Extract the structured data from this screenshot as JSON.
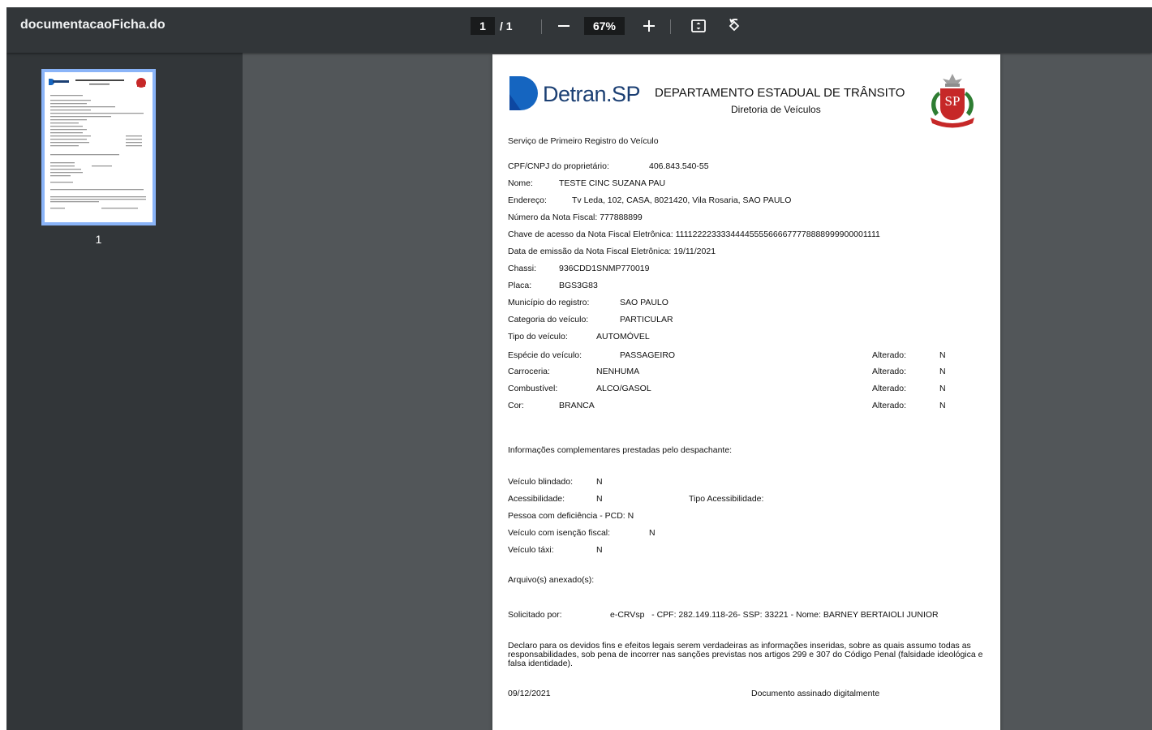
{
  "toolbar": {
    "file_name": "documentacaoFicha.do",
    "current_page": "1",
    "page_separator": "/",
    "total_pages": "1",
    "zoom": "67%",
    "icons": [
      "minus-icon",
      "plus-icon",
      "fit-page-icon",
      "rotate-icon"
    ]
  },
  "sidebar": {
    "thumbnail_label": "1",
    "accent": "#8ab4f8"
  },
  "document": {
    "brand": "Detran.SP",
    "brand_main": "Detran",
    "brand_suffix": ".SP",
    "department": "DEPARTAMENTO ESTADUAL DE TRÂNSITO",
    "directorate": "Diretoria de Veículos",
    "seal_text": "SP",
    "service": "Serviço de Primeiro Registro do Veículo",
    "cpf_label": "CPF/CNPJ do proprietário:",
    "cpf_value": "406.843.540-55",
    "nome_label": "Nome:",
    "nome_value": "TESTE CINC SUZANA PAU",
    "endereco_label": "Endereço:",
    "endereco_value": "Tv Leda, 102, CASA, 8021420, Vila Rosaria, SAO PAULO",
    "nota_fiscal": "Número da Nota Fiscal: 777888899",
    "chave_acesso": "Chave de acesso da Nota Fiscal Eletrônica: 11112222333344445555666677778888999900001111",
    "data_emissao": "Data de emissão da Nota Fiscal Eletrônica: 19/11/2021",
    "chassi_label": "Chassi:",
    "chassi_value": "936CDD1SNMP770019",
    "placa_label": "Placa:",
    "placa_value": "BGS3G83",
    "municipio_label": "Município do registro:",
    "municipio_value": "SAO PAULO",
    "categoria_label": "Categoria do veículo:",
    "categoria_value": "PARTICULAR",
    "tipo_label": "Tipo do veículo:",
    "tipo_value": "AUTOMÓVEL",
    "especie_label": "Espécie do veículo:",
    "especie_value": "PASSAGEIRO",
    "carroceria_label": "Carroceria:",
    "carroceria_value": "NENHUMA",
    "combustivel_label": "Combustível:",
    "combustivel_value": "ALCO/GASOL",
    "cor_label": "Cor:",
    "cor_value": "BRANCA",
    "alterado_label": "Alterado:",
    "alterado_value": "N",
    "info_title": "Informações complementares prestadas pelo despachante:",
    "blindado_label": "Veículo blindado:",
    "blindado_value": "N",
    "acessibilidade_label": "Acessibilidade:",
    "acessibilidade_value": "N",
    "tipo_acessibilidade_label": "Tipo Acessibilidade:",
    "pcd": "Pessoa com deficiência - PCD: N",
    "isencao_label": "Veículo com isenção fiscal:",
    "isencao_value": "N",
    "taxi_label": "Veículo táxi:",
    "taxi_value": "N",
    "arquivos_label": "Arquivo(s) anexado(s):",
    "solicitado_label": "Solicitado por:",
    "solicitado_value": "e-CRVsp   - CPF: 282.149.118-26- SSP: 33221 - Nome: BARNEY BERTAIOLI JUNIOR",
    "declaracao": "Declaro para os devidos fins e efeitos legais serem verdadeiras as informações inseridas, sobre as quais assumo todas as responsabilidades, sob pena de incorrer nas sanções previstas nos artigos 299 e 307 do Código Penal (falsidade ideológica e falsa identidade).",
    "data_assinatura": "09/12/2021",
    "assinatura": "Documento assinado digitalmente",
    "brand_color": "#1565c0",
    "seal_color": "#c62828"
  }
}
